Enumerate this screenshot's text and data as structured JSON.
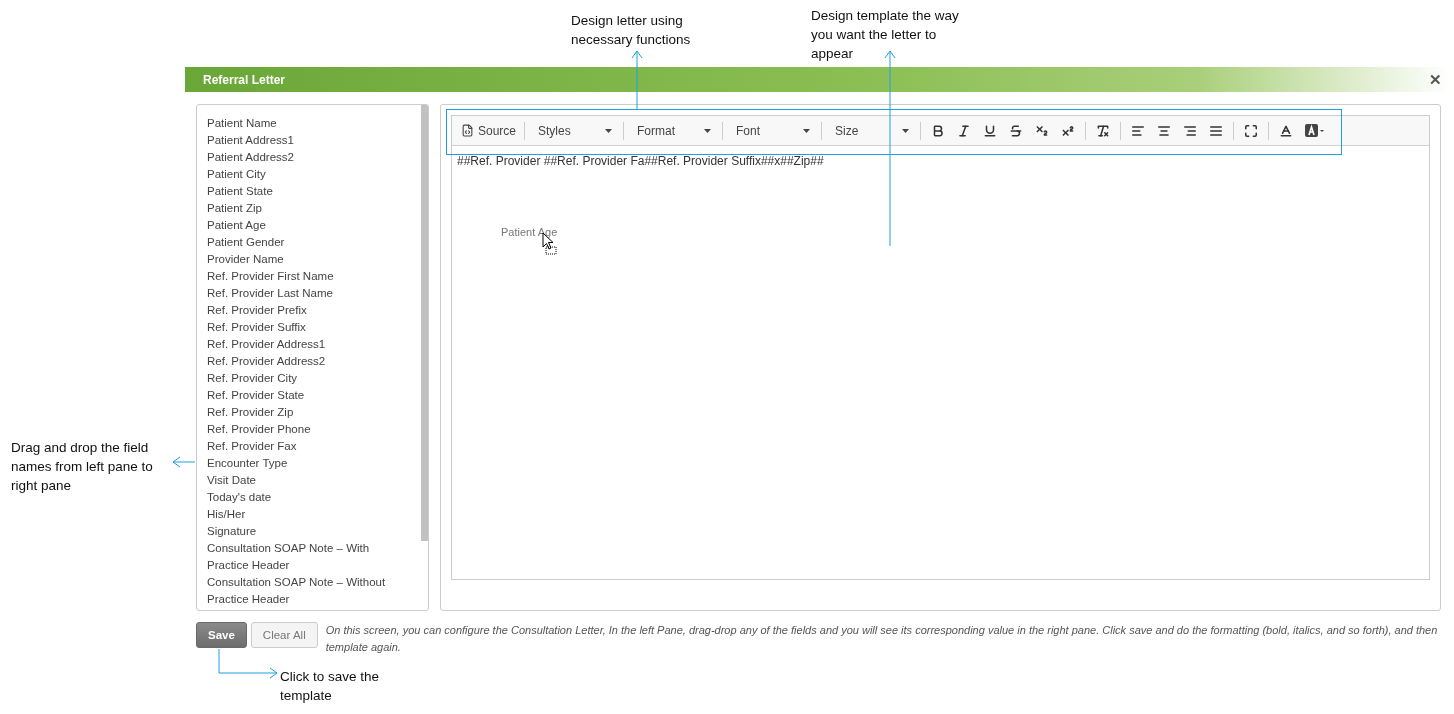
{
  "annotations": [
    {
      "text": "Design letter using necessary functions"
    },
    {
      "text": "Design template the way you want the letter to appear"
    },
    {
      "text": "Drag and drop the field names from left pane to right pane"
    },
    {
      "text": "Click to save the template"
    }
  ],
  "dialog": {
    "title": "Referral Letter",
    "close": "✕"
  },
  "fields": [
    "Patient Name",
    "Patient Address1",
    "Patient Address2",
    "Patient City",
    "Patient State",
    "Patient Zip",
    "Patient Age",
    "Patient Gender",
    "Provider Name",
    "Ref. Provider First Name",
    "Ref. Provider Last Name",
    "Ref. Provider Prefix",
    "Ref. Provider Suffix",
    "Ref. Provider Address1",
    "Ref. Provider Address2",
    "Ref. Provider City",
    "Ref. Provider State",
    "Ref. Provider Zip",
    "Ref. Provider Phone",
    "Ref. Provider Fax",
    "Encounter Type",
    "Visit Date",
    "Today's date",
    "His/Her",
    "Signature",
    "Consultation SOAP Note – With Practice Header",
    "Consultation SOAP Note – Without Practice Header"
  ],
  "toolbar": {
    "source": "Source",
    "dropdowns": [
      "Styles",
      "Format",
      "Font",
      "Size"
    ]
  },
  "editor": {
    "content": "##Ref. Provider ##Ref. Provider Fa##Ref. Provider Suffix##x##Zip##",
    "dragged_field": "Patient Age"
  },
  "buttons": [
    {
      "label": "Save",
      "kind": "primary"
    },
    {
      "label": "Clear All",
      "kind": "secondary"
    }
  ],
  "help_text": "On this screen, you can configure the Consultation Letter, In the left Pane, drag-drop any of the fields and you will see its corresponding value in the right pane. Click save and do the formatting (bold, italics, and so forth), and then template again."
}
